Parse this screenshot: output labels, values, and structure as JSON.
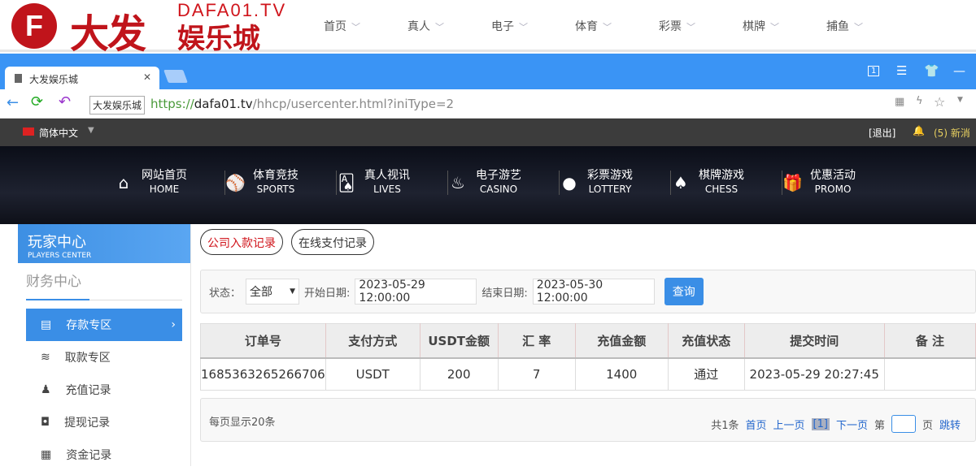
{
  "site": {
    "logo_letter": "F",
    "logo_name": "大发",
    "logo_domain": "DAFA01.TV",
    "logo_sub": "娱乐城",
    "nav": [
      "首页",
      "真人",
      "电子",
      "体育",
      "彩票",
      "棋牌",
      "捕鱼"
    ]
  },
  "browser": {
    "tab_title": "大发娱乐城",
    "tooltip": "大发娱乐城",
    "url_scheme": "https://",
    "url_host": "dafa01.tv",
    "url_path": "/hhcp/usercenter.html?iniType=2",
    "tab_count": "1"
  },
  "topbar": {
    "language": "简体中文",
    "logout": "[退出]",
    "messages": "(5) 新消"
  },
  "mainnav": [
    {
      "icon": "home-icon",
      "glyph": "⌂",
      "cn": "网站首页",
      "en": "HOME"
    },
    {
      "icon": "ball-icon",
      "glyph": "⚾",
      "cn": "体育竞技",
      "en": "SPORTS"
    },
    {
      "icon": "cards-icon",
      "glyph": "🂡",
      "cn": "真人视讯",
      "en": "LIVES"
    },
    {
      "icon": "casino-icon",
      "glyph": "♨",
      "cn": "电子游艺",
      "en": "CASINO"
    },
    {
      "icon": "lottery-icon",
      "glyph": "●",
      "cn": "彩票游戏",
      "en": "LOTTERY"
    },
    {
      "icon": "chess-icon",
      "glyph": "♠",
      "cn": "棋牌游戏",
      "en": "CHESS"
    },
    {
      "icon": "gift-icon",
      "glyph": "🎁",
      "cn": "优惠活动",
      "en": "PROMO"
    }
  ],
  "sidebar": {
    "title": "玩家中心",
    "subtitle": "PLAYERS CENTER",
    "section": "财务中心",
    "items": [
      {
        "label": "存款专区",
        "glyph": "▤",
        "icon": "card-icon"
      },
      {
        "label": "取款专区",
        "glyph": "≋",
        "icon": "cash-icon"
      },
      {
        "label": "充值记录",
        "glyph": "♟",
        "icon": "moneybag-icon"
      },
      {
        "label": "提现记录",
        "glyph": "◘",
        "icon": "withdraw-icon"
      },
      {
        "label": "资金记录",
        "glyph": "▦",
        "icon": "funds-icon"
      }
    ]
  },
  "main": {
    "tabs": [
      "公司入款记录",
      "在线支付记录"
    ],
    "filter": {
      "status_label": "状态：",
      "status_value": "全部",
      "start_label": "开始日期:",
      "start_value": "2023-05-29 12:00:00",
      "end_label": "结束日期:",
      "end_value": "2023-05-30 12:00:00",
      "query": "查询"
    },
    "table": {
      "headers": [
        "订单号",
        "支付方式",
        "USDT金额",
        "汇 率",
        "充值金额",
        "充值状态",
        "提交时间",
        "备 注"
      ],
      "rows": [
        [
          "1685363265266706",
          "USDT",
          "200",
          "7",
          "1400",
          "通过",
          "2023-05-29 20:27:45",
          ""
        ]
      ]
    },
    "pager": {
      "per_page": "每页显示20条",
      "total": "共1条",
      "first": "首页",
      "prev": "上一页",
      "current": "[1]",
      "next": "下一页",
      "page_prefix": "第",
      "page_suffix": "页",
      "jump": "跳转"
    }
  },
  "colors": {
    "brand_red": "#c0141b",
    "accent_blue": "#3a8ee6"
  }
}
